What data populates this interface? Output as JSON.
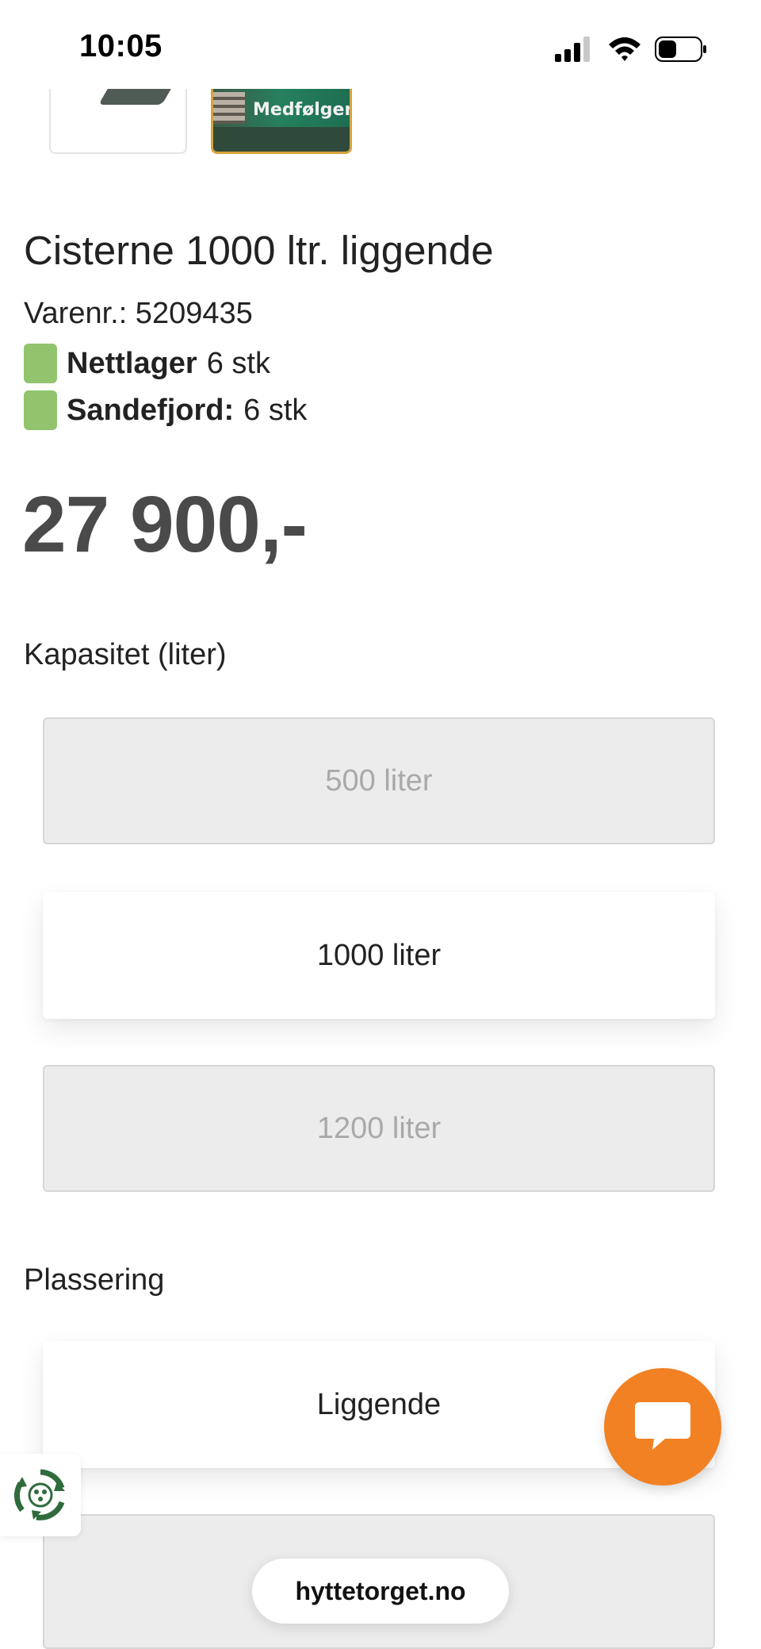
{
  "status_bar": {
    "time": "10:05",
    "icons": [
      "signal-icon",
      "wifi-icon",
      "battery-icon"
    ]
  },
  "thumbnails": [
    {
      "label": ""
    },
    {
      "label": "Medfølger",
      "selected": true
    }
  ],
  "product": {
    "title": "Cisterne 1000 ltr. liggende",
    "sku": "Varenr.: 5209435",
    "stock": [
      {
        "location": "Nettlager",
        "quantity": "6 stk"
      },
      {
        "location": "Sandefjord:",
        "quantity": "6 stk"
      }
    ],
    "price": "27 900,-"
  },
  "capacity": {
    "label": "Kapasitet (liter)",
    "options": [
      {
        "label": "500 liter",
        "state": "disabled"
      },
      {
        "label": "1000 liter",
        "state": "selected"
      },
      {
        "label": "1200 liter",
        "state": "disabled"
      }
    ]
  },
  "placement": {
    "label": "Plassering",
    "options": [
      {
        "label": "Liggende",
        "state": "selected"
      },
      {
        "label": "",
        "state": "disabled"
      }
    ]
  },
  "chat": {
    "icon": "chat-bubble-icon"
  },
  "eco_badge": {
    "icon": "recycle-icon"
  },
  "browser": {
    "url": "hyttetorget.no"
  },
  "colors": {
    "accent_orange": "#f28123",
    "stock_green": "#91c46d",
    "selected_thumb_border": "#d9a23a",
    "price_text": "#4a4a4a",
    "disabled_bg": "#ececec"
  }
}
